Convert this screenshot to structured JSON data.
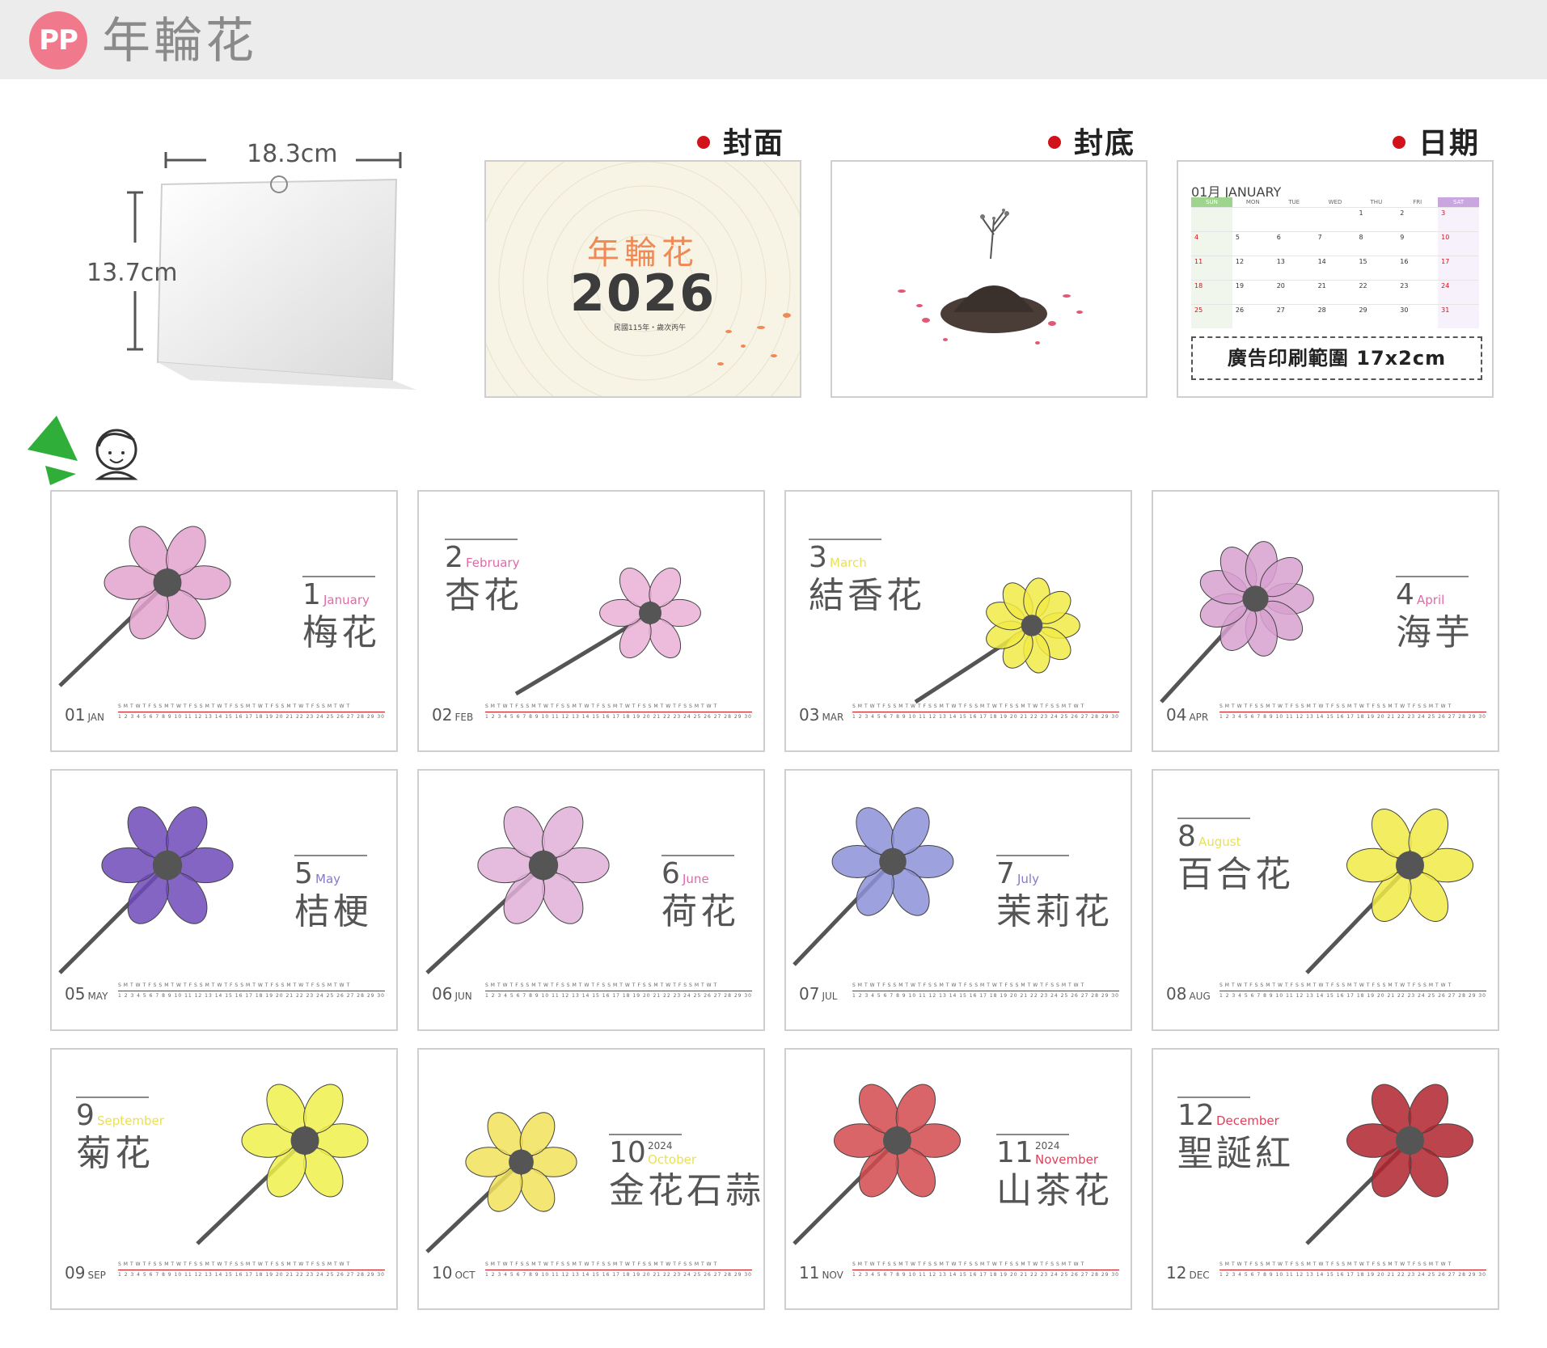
{
  "header": {
    "badge": "PP",
    "title": "年輪花"
  },
  "product": {
    "width_label": "18.3cm",
    "height_label": "13.7cm"
  },
  "previews": {
    "cover": {
      "label": "封面",
      "title": "年輪花",
      "year": "2026",
      "subtitle": "民國115年・歲次丙午"
    },
    "back": {
      "label": "封底"
    },
    "date": {
      "label": "日期",
      "month_heading": "01月 JANUARY",
      "weekdays": [
        "SUN",
        "MON",
        "TUE",
        "WED",
        "THU",
        "FRI",
        "SAT"
      ],
      "weeks": [
        [
          "",
          "",
          "",
          "",
          "1",
          "2",
          "3"
        ],
        [
          "4",
          "5",
          "6",
          "7",
          "8",
          "9",
          "10"
        ],
        [
          "11",
          "12",
          "13",
          "14",
          "15",
          "16",
          "17"
        ],
        [
          "18",
          "19",
          "20",
          "21",
          "22",
          "23",
          "24"
        ],
        [
          "25",
          "26",
          "27",
          "28",
          "29",
          "30",
          "31"
        ]
      ],
      "ad_text": "廣告印刷範圍 17x2cm"
    }
  },
  "months": [
    {
      "num": "1",
      "eng": "January",
      "cn": "梅花",
      "code": "01",
      "abbr": "JAN",
      "year": "",
      "accent": "#e06aa8",
      "flower_color": "#e3a3cf",
      "flower": "blossom"
    },
    {
      "num": "2",
      "eng": "February",
      "cn": "杏花",
      "code": "02",
      "abbr": "FEB",
      "year": "",
      "accent": "#e06aa8",
      "flower_color": "#eab0d6",
      "flower": "blossom"
    },
    {
      "num": "3",
      "eng": "March",
      "cn": "結香花",
      "code": "03",
      "abbr": "MAR",
      "year": "",
      "accent": "#e8e05a",
      "flower_color": "#f1ea45",
      "flower": "cluster"
    },
    {
      "num": "4",
      "eng": "April",
      "cn": "海芋",
      "code": "04",
      "abbr": "APR",
      "year": "",
      "accent": "#e06aa8",
      "flower_color": "#d7a1cf",
      "flower": "bouquet"
    },
    {
      "num": "5",
      "eng": "May",
      "cn": "桔梗",
      "code": "05",
      "abbr": "MAY",
      "year": "",
      "accent": "#8a78c8",
      "flower_color": "#6e4ab8",
      "flower": "bell"
    },
    {
      "num": "6",
      "eng": "June",
      "cn": "荷花",
      "code": "06",
      "abbr": "JUN",
      "year": "",
      "accent": "#e06aa8",
      "flower_color": "#e0b0d8",
      "flower": "lotus"
    },
    {
      "num": "7",
      "eng": "July",
      "cn": "茉莉花",
      "code": "07",
      "abbr": "JUL",
      "year": "",
      "accent": "#8a78c8",
      "flower_color": "#8c90d8",
      "flower": "bell"
    },
    {
      "num": "8",
      "eng": "August",
      "cn": "百合花",
      "code": "08",
      "abbr": "AUG",
      "year": "",
      "accent": "#e8e05a",
      "flower_color": "#f1ea45",
      "flower": "lily"
    },
    {
      "num": "9",
      "eng": "September",
      "cn": "菊花",
      "code": "09",
      "abbr": "SEP",
      "year": "",
      "accent": "#e8e05a",
      "flower_color": "#eef04a",
      "flower": "sunflower"
    },
    {
      "num": "10",
      "eng": "October",
      "cn": "金花石蒜",
      "code": "10",
      "abbr": "OCT",
      "year": "2024",
      "accent": "#e8e05a",
      "flower_color": "#f2e25a",
      "flower": "spider"
    },
    {
      "num": "11",
      "eng": "November",
      "cn": "山茶花",
      "code": "11",
      "abbr": "NOV",
      "year": "2024",
      "accent": "#e0405a",
      "flower_color": "#d44a4f",
      "flower": "camellia"
    },
    {
      "num": "12",
      "eng": "December",
      "cn": "聖誕紅",
      "code": "12",
      "abbr": "DEC",
      "year": "",
      "accent": "#e0405a",
      "flower_color": "#b0242e",
      "flower": "poinsettia"
    }
  ],
  "colors": {
    "red_dot": "#d1121b",
    "badge": "#f07a8c",
    "mascot_green": "#2fae3a"
  }
}
